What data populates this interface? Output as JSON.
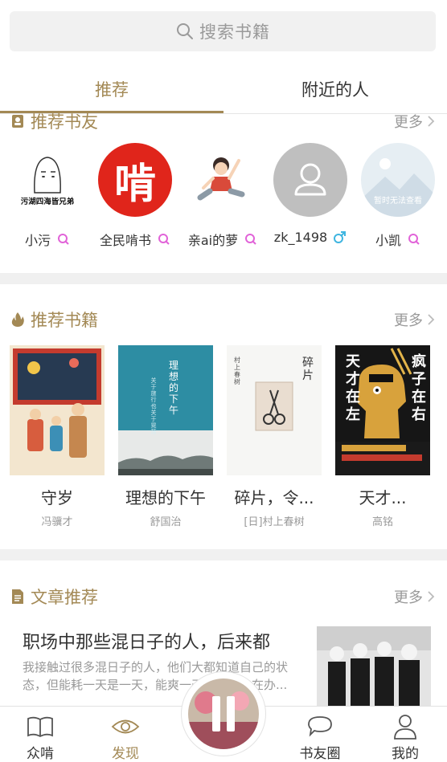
{
  "search": {
    "placeholder": "搜索书籍"
  },
  "tabs": [
    {
      "label": "推荐",
      "active": true
    },
    {
      "label": "附近的人",
      "active": false
    }
  ],
  "friends_section": {
    "title": "推荐书友",
    "more": "更多",
    "items": [
      {
        "name": "小污",
        "gender": "female",
        "avatar_text": "污湖四海皆兄弟"
      },
      {
        "name": "全民啃书",
        "gender": "female",
        "avatar_text": "啃"
      },
      {
        "name": "亲ai的萝",
        "gender": "female"
      },
      {
        "name": "zk_1498",
        "gender": "male"
      },
      {
        "name": "小凯",
        "gender": "female",
        "avatar_text": "暂时无法查看"
      }
    ]
  },
  "books_section": {
    "title": "推荐书籍",
    "more": "更多",
    "items": [
      {
        "title": "守岁",
        "author": "冯骥才"
      },
      {
        "title": "理想的下午",
        "author": "舒国治",
        "cover_text": "理想的下午",
        "cover_sub": "关于旅行也关于晃荡"
      },
      {
        "title": "碎片，令...",
        "author": "[日]村上春树",
        "cover_text": "碎片",
        "cover_author": "村上春树"
      },
      {
        "title": "天才...",
        "author": "高铭",
        "cover_left": "天才在左",
        "cover_right": "疯子在右"
      }
    ]
  },
  "articles_section": {
    "title": "文章推荐",
    "more": "更多",
    "items": [
      {
        "title": "职场中那些混日子的人，后来都",
        "summary": "我接触过很多混日子的人，他们大都知道自己的状态，但能耗一天是一天，能爽一天是一天，在办..."
      }
    ]
  },
  "bottom_nav": [
    {
      "label": "众啃",
      "icon": "book-icon"
    },
    {
      "label": "发现",
      "icon": "eye-icon",
      "active": true
    },
    {
      "label": "书友圈",
      "icon": "chat-icon"
    },
    {
      "label": "我的",
      "icon": "person-icon"
    }
  ],
  "colors": {
    "accent": "#a38955",
    "female": "#e163d8",
    "male": "#3fb5e0"
  }
}
